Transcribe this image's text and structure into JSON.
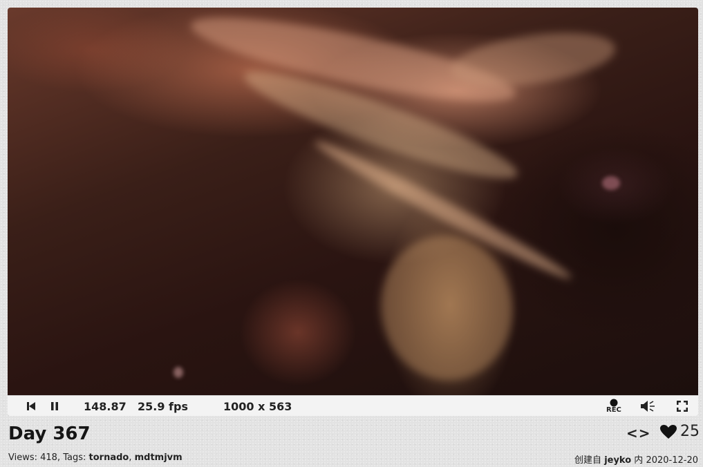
{
  "player": {
    "time": "148.87",
    "fps": "25.9 fps",
    "resolution": "1000 x 563",
    "rec_label": "REC",
    "icons": {
      "rewind": "skip-back-icon",
      "pause": "pause-icon",
      "record": "record-icon",
      "volume": "volume-icon",
      "fullscreen": "fullscreen-icon"
    }
  },
  "shader": {
    "title": "Day 367",
    "views_label": "Views: 418, Tags: ",
    "tags": [
      "tornado",
      "mdtmjvm"
    ],
    "tag_separator": ", ",
    "likes": "25",
    "created_prefix": "创建自 ",
    "author": "jeyko",
    "created_mid": " 内 ",
    "date": "2020-12-20",
    "code_toggle": "<>"
  },
  "colors": {
    "background": "#e2e2e2",
    "control_bar": "#f3f3f3",
    "text": "#111111"
  }
}
